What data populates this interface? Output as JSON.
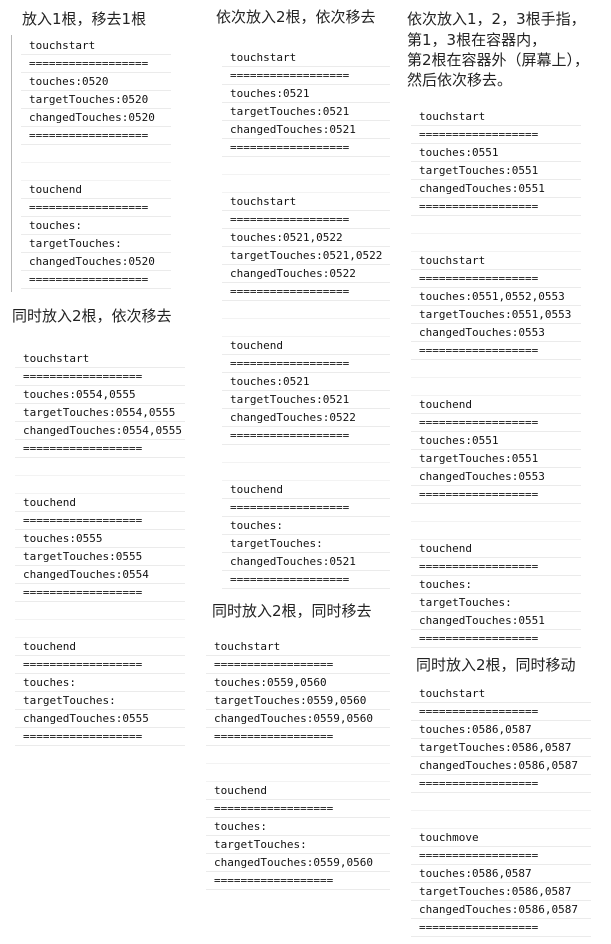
{
  "headings": {
    "h1": "放入1根，移去1根",
    "h2": "依次放入2根，依次移去",
    "h3_line1": "依次放入1，2，3根手指，",
    "h3_line2": "第1，3根在容器内，",
    "h3_line3": "第2根在容器外（屏幕上），",
    "h3_line4": "然后依次移去。",
    "h4": "同时放入2根，依次移去",
    "h5": "同时放入2根，同时移去",
    "h6": "同时放入2根，同时移动"
  },
  "logs": {
    "log1": [
      "touchstart",
      "==================",
      "touches:0520",
      "targetTouches:0520",
      "changedTouches:0520",
      "==================",
      "",
      "",
      "touchend",
      "==================",
      "touches:",
      "targetTouches:",
      "changedTouches:0520",
      "=================="
    ],
    "log2": [
      "touchstart",
      "==================",
      "touches:0521",
      "targetTouches:0521",
      "changedTouches:0521",
      "==================",
      "",
      "",
      "touchstart",
      "==================",
      "touches:0521,0522",
      "targetTouches:0521,0522",
      "changedTouches:0522",
      "==================",
      "",
      "",
      "touchend",
      "==================",
      "touches:0521",
      "targetTouches:0521",
      "changedTouches:0522",
      "==================",
      "",
      "",
      "touchend",
      "==================",
      "touches:",
      "targetTouches:",
      "changedTouches:0521",
      "=================="
    ],
    "log3": [
      "touchstart",
      "==================",
      "touches:0551",
      "targetTouches:0551",
      "changedTouches:0551",
      "==================",
      "",
      "",
      "touchstart",
      "==================",
      "touches:0551,0552,0553",
      "targetTouches:0551,0553",
      "changedTouches:0553",
      "==================",
      "",
      "",
      "touchend",
      "==================",
      "touches:0551",
      "targetTouches:0551",
      "changedTouches:0553",
      "==================",
      "",
      "",
      "touchend",
      "==================",
      "touches:",
      "targetTouches:",
      "changedTouches:0551",
      "=================="
    ],
    "log4": [
      "touchstart",
      "==================",
      "touches:0554,0555",
      "targetTouches:0554,0555",
      "changedTouches:0554,0555",
      "==================",
      "",
      "",
      "touchend",
      "==================",
      "touches:0555",
      "targetTouches:0555",
      "changedTouches:0554",
      "==================",
      "",
      "",
      "touchend",
      "==================",
      "touches:",
      "targetTouches:",
      "changedTouches:0555",
      "=================="
    ],
    "log5": [
      "touchstart",
      "==================",
      "touches:0559,0560",
      "targetTouches:0559,0560",
      "changedTouches:0559,0560",
      "==================",
      "",
      "",
      "touchend",
      "==================",
      "touches:",
      "targetTouches:",
      "changedTouches:0559,0560",
      "=================="
    ],
    "log6": [
      "touchstart",
      "==================",
      "touches:0586,0587",
      "targetTouches:0586,0587",
      "changedTouches:0586,0587",
      "==================",
      "",
      "",
      "touchmove",
      "==================",
      "touches:0586,0587",
      "targetTouches:0586,0587",
      "changedTouches:0586,0587",
      "=================="
    ]
  },
  "colors": {
    "text": "#111111",
    "row_border": "#ebebeb",
    "container_line": "#b8b8b8"
  }
}
